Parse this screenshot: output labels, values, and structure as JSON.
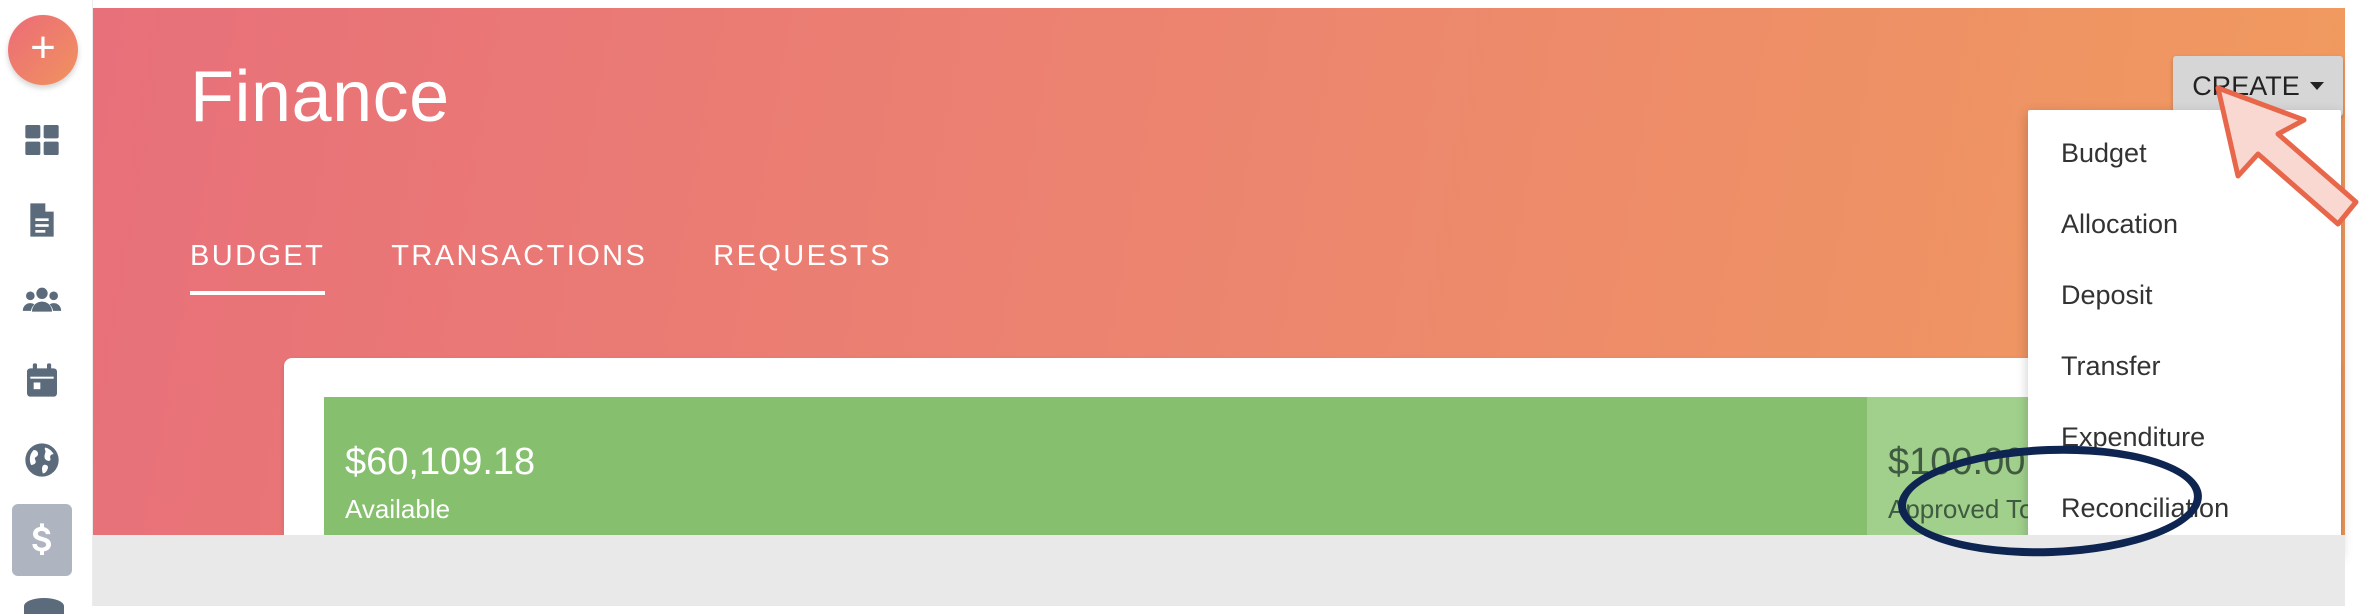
{
  "app": {
    "title": "Finance"
  },
  "rail": {
    "items": [
      {
        "icon": "plus-icon"
      },
      {
        "icon": "dashboard-icon"
      },
      {
        "icon": "document-icon"
      },
      {
        "icon": "users-icon"
      },
      {
        "icon": "calendar-icon"
      },
      {
        "icon": "globe-icon"
      },
      {
        "icon": "dollar-icon",
        "active": true
      }
    ]
  },
  "fab_label": "+",
  "tabs": [
    {
      "label": "BUDGET",
      "active": true
    },
    {
      "label": "TRANSACTIONS",
      "active": false
    },
    {
      "label": "REQUESTS",
      "active": false
    }
  ],
  "budget": {
    "available": {
      "amount": "$60,109.18",
      "label": "Available"
    },
    "approved": {
      "amount": "$100.00",
      "label": "Approved To"
    }
  },
  "create": {
    "label": "CREATE",
    "menu": [
      "Budget",
      "Allocation",
      "Deposit",
      "Transfer",
      "Expenditure",
      "Reconciliation"
    ]
  },
  "colors": {
    "header_start": "#e8707a",
    "header_end": "#f09b5e",
    "available_bar": "#86bf6e",
    "approved_bar": "#a1d08c",
    "highlight_ring": "#0e2451",
    "arrow_fill": "#f8d8d0",
    "arrow_stroke": "#e8664a"
  }
}
